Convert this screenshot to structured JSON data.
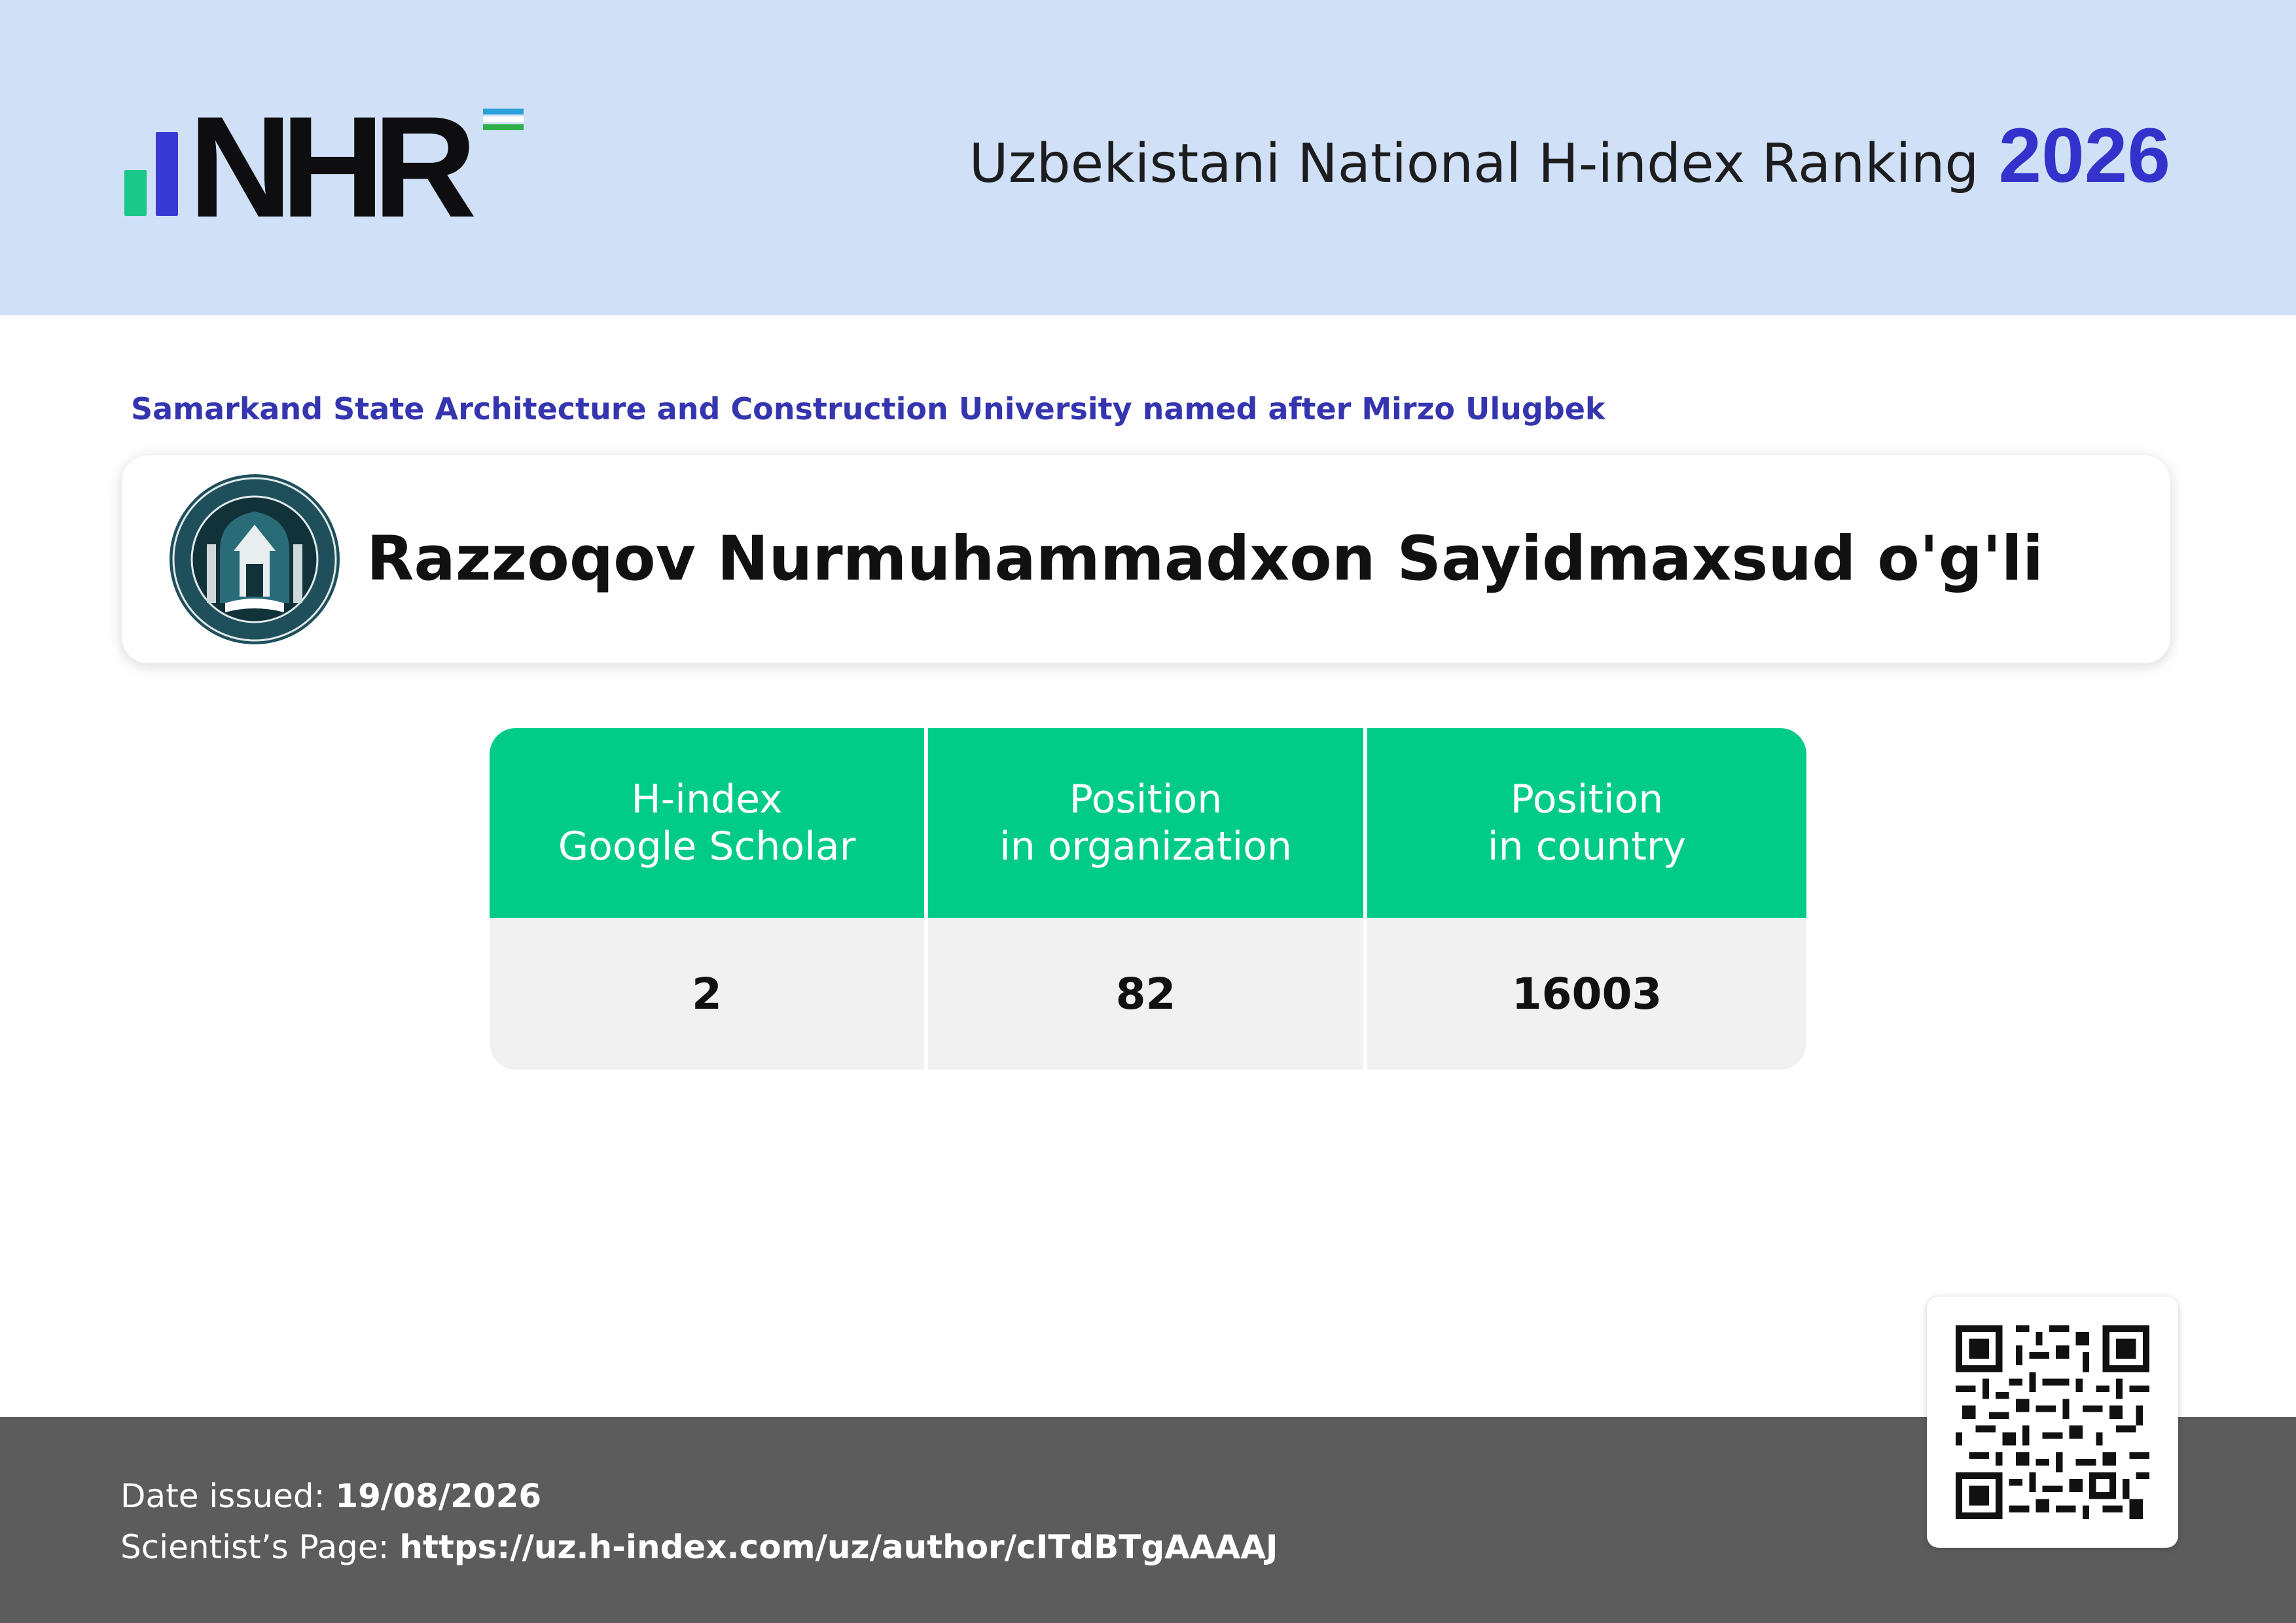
{
  "header": {
    "logo_text": "NHR",
    "title": "Uzbekistani National H-index Ranking",
    "year": "2026",
    "colors": {
      "background": "#d0e1f7",
      "year": "#3333cc",
      "logo_green": "#19c88a",
      "logo_blue": "#3838d2"
    }
  },
  "organization": "Samarkand State Architecture and Construction University named after Mirzo Ulugbek",
  "scientist": {
    "name": "Razzoqov Nurmuhammadxon Sayidmaxsud o'g'li",
    "seal_icon": "university-seal-icon"
  },
  "stats": {
    "columns": [
      {
        "header_line1": "H-index",
        "header_line2": "Google Scholar",
        "value": "2"
      },
      {
        "header_line1": "Position",
        "header_line2": "in organization",
        "value": "82"
      },
      {
        "header_line1": "Position",
        "header_line2": "in country",
        "value": "16003"
      }
    ],
    "colors": {
      "header": "#00cc87",
      "body": "#f1f1f1"
    }
  },
  "footer": {
    "date_label": "Date issued:",
    "date_value": "19/08/2026",
    "page_label": "Scientist’s Page:",
    "page_value": "https://uz.h-index.com/uz/author/cITdBTgAAAAJ",
    "qr_icon": "qr-code-icon",
    "background": "#5c5c5c"
  }
}
